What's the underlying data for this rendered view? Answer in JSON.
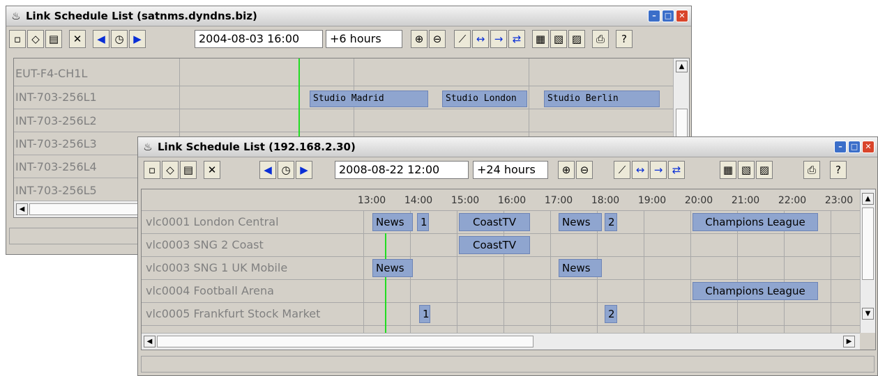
{
  "colors": {
    "bar": "#8fa5cf",
    "now_line": "#22dd22",
    "window_bg": "#d4d0c8"
  },
  "toolbar_icons": [
    "new-icon",
    "eraser-icon",
    "properties-icon",
    "delete-icon",
    "previous-icon",
    "clock-icon",
    "next-icon",
    "zoom-in-icon",
    "zoom-out-icon",
    "link-icon",
    "arrow-left-right-icon",
    "arrow-right-icon",
    "swap-icon",
    "report-icon",
    "export-icon",
    "report-settings-icon",
    "print-icon",
    "help-icon"
  ],
  "back_window": {
    "title": "Link Schedule List (satnms.dyndns.biz)",
    "date": "2004-08-03 16:00",
    "span": "+6 hours",
    "rows": [
      "EUT-F4-CH1L",
      "INT-703-256L1",
      "INT-703-256L2",
      "INT-703-256L3",
      "INT-703-256L4",
      "INT-703-256L5"
    ],
    "bookings": {
      "b1": "Studio Madrid",
      "b2": "Studio London",
      "b3": "Studio Berlin"
    }
  },
  "front_window": {
    "title": "Link Schedule List (192.168.2.30)",
    "date": "2008-08-22 12:00",
    "span": "+24 hours",
    "hours": [
      "13:00",
      "14:00",
      "15:00",
      "16:00",
      "17:00",
      "18:00",
      "19:00",
      "20:00",
      "21:00",
      "22:00",
      "23:00"
    ],
    "rows": [
      "vlc0001 London Central",
      "vlc0003 SNG 2 Coast",
      "vlc0003 SNG 1 UK Mobile",
      "vlc0004 Football Arena",
      "vlc0005 Frankfurt Stock Market"
    ],
    "bookings": {
      "r1_news": "News",
      "r1_one": "1",
      "r1_coast": "CoastTV",
      "r1_news2": "News",
      "r1_two": "2",
      "r1_champ": "Champions League",
      "r2_coast": "CoastTV",
      "r3_news": "News",
      "r3_news2": "News",
      "r4_champ": "Champions League",
      "r5_one": "1",
      "r5_two": "2"
    }
  }
}
